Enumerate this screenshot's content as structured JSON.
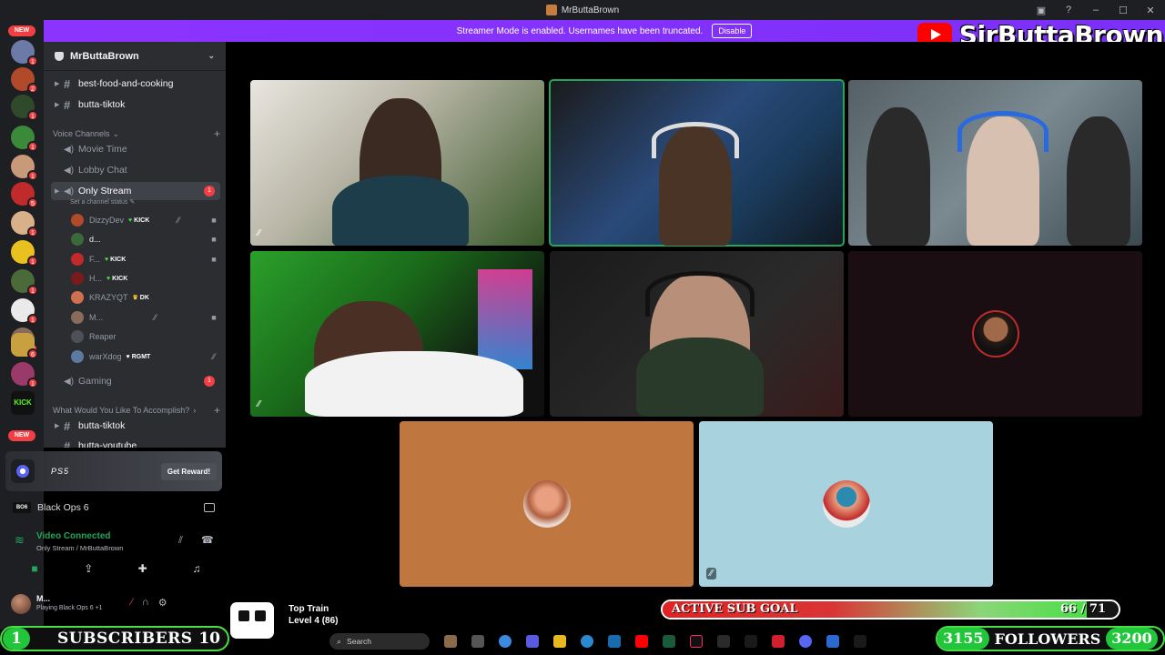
{
  "window": {
    "title": "MrButtaBrown"
  },
  "banner": {
    "text": "Streamer Mode is enabled. Usernames have been truncated.",
    "button": "Disable"
  },
  "overlay": {
    "channel_name": "SirButtaBrown"
  },
  "server_rail": {
    "new_top": "NEW",
    "new_bottom": "NEW",
    "kick_label": "KICK",
    "badges": [
      "1",
      "2",
      "1",
      "1",
      "1",
      "5",
      "1",
      "1",
      "1",
      "1",
      "11",
      "6",
      "1",
      "1",
      "1"
    ]
  },
  "server": {
    "name": "MrButtaBrown"
  },
  "channels": {
    "top_text": [
      "best-food-and-cooking",
      "butta-tiktok"
    ],
    "voice_category": "Voice Channels",
    "voice": [
      "Movie Time",
      "Lobby Chat",
      "Only Stream",
      "Gaming"
    ],
    "only_stream_badge": "1",
    "gaming_badge": "1",
    "status_hint": "Set a channel status",
    "accomplish_category": "What Would You Like To Accomplish?",
    "bottom_text": [
      "butta-tiktok",
      "butta-youtube"
    ]
  },
  "voice_users": [
    {
      "name": "DizzyDev",
      "tag": "KICK",
      "tag_symbol": "♥"
    },
    {
      "name": "d...",
      "tag": "",
      "tag_symbol": ""
    },
    {
      "name": "F...",
      "tag": "KICK",
      "tag_symbol": "♥"
    },
    {
      "name": "H...",
      "tag": "KICK",
      "tag_symbol": "♥"
    },
    {
      "name": "KRAZYQT",
      "tag": "DK",
      "tag_symbol": "♛"
    },
    {
      "name": "M...",
      "tag": "",
      "tag_symbol": ""
    },
    {
      "name": "Reaper",
      "tag": "",
      "tag_symbol": ""
    },
    {
      "name": "warXdog",
      "tag": "RGMT",
      "tag_symbol": "♥"
    }
  ],
  "reward": {
    "platform": "PS5",
    "button": "Get Reward!"
  },
  "activity": {
    "game_icon": "BO6",
    "game": "Black Ops 6"
  },
  "voice_connection": {
    "status": "Video Connected",
    "location": "Only Stream / MrButtaBrown"
  },
  "user_panel": {
    "name": "M...",
    "status": "Playing Black Ops 6 +1"
  },
  "train": {
    "title": "Top Train",
    "level": "Level 4 (86)"
  },
  "sub_goal": {
    "label": "ACTIVE SUB GOAL",
    "current": 66,
    "target": 71,
    "display": "66 / 71"
  },
  "subscribers": {
    "current": "1",
    "label": "SUBSCRIBERS",
    "goal": "10"
  },
  "followers": {
    "current": "3155",
    "label": "FOLLOWERS",
    "goal": "3200"
  },
  "taskbar": {
    "search": "Search"
  },
  "colors": {
    "accent_green": "#23a55a",
    "banner_purple": "#7b2ff7",
    "youtube_red": "#ff0000",
    "discord_bg": "#2b2d31"
  }
}
